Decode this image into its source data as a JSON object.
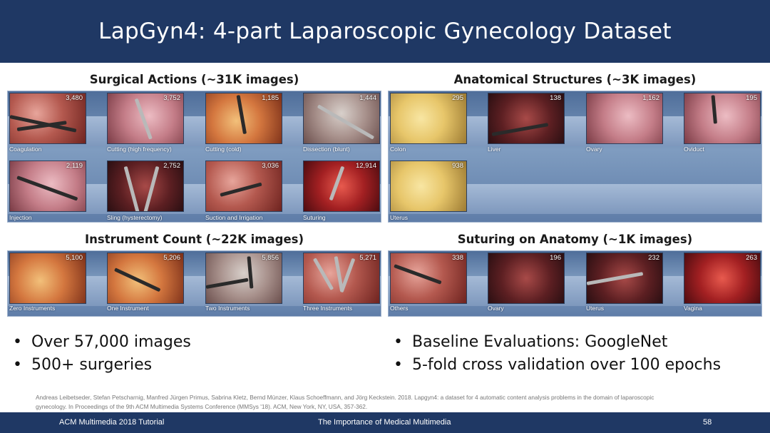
{
  "slide": {
    "title": "LapGyn4: 4-part Laparoscopic Gynecology Dataset"
  },
  "sections": {
    "surgical_actions": {
      "title": "Surgical Actions (~31K images)",
      "items": [
        {
          "label": "Coagulation",
          "count": "3,480"
        },
        {
          "label": "Cutting (high frequency)",
          "count": "3,752"
        },
        {
          "label": "Cutting (cold)",
          "count": "1,185"
        },
        {
          "label": "Dissection (blunt)",
          "count": "1,444"
        },
        {
          "label": "Injection",
          "count": "2,119"
        },
        {
          "label": "Sling (hysterectomy)",
          "count": "2,752"
        },
        {
          "label": "Suction and Irrigation",
          "count": "3,036"
        },
        {
          "label": "Suturing",
          "count": "12,914"
        }
      ]
    },
    "anatomical_structures": {
      "title": "Anatomical Structures (~3K images)",
      "items": [
        {
          "label": "Colon",
          "count": "295"
        },
        {
          "label": "Liver",
          "count": "138"
        },
        {
          "label": "Ovary",
          "count": "1,162"
        },
        {
          "label": "Oviduct",
          "count": "195"
        },
        {
          "label": "Uterus",
          "count": "938"
        }
      ]
    },
    "instrument_count": {
      "title": "Instrument Count (~22K images)",
      "items": [
        {
          "label": "Zero Instruments",
          "count": "5,100"
        },
        {
          "label": "One Instrument",
          "count": "5,206"
        },
        {
          "label": "Two Instruments",
          "count": "5,856"
        },
        {
          "label": "Three Instruments",
          "count": "5,271"
        }
      ]
    },
    "suturing_anatomy": {
      "title": "Suturing on Anatomy (~1K images)",
      "items": [
        {
          "label": "Others",
          "count": "338"
        },
        {
          "label": "Ovary",
          "count": "196"
        },
        {
          "label": "Uterus",
          "count": "232"
        },
        {
          "label": "Vagina",
          "count": "263"
        }
      ]
    }
  },
  "bullets": {
    "left": [
      "Over 57,000 images",
      "500+ surgeries"
    ],
    "right": [
      "Baseline Evaluations: GoogleNet",
      "5-fold cross validation over 100 epochs"
    ]
  },
  "citation": {
    "line1": "Andreas Leibetseder, Stefan Petscharnig, Manfred Jürgen Primus, Sabrina Kletz, Bernd Münzer, Klaus Schoeffmann, and Jörg Keckstein. 2018. Lapgyn4: a dataset for 4 automatic content analysis problems in the domain of laparoscopic",
    "line2": "gynecology. In Proceedings of the 9th ACM Multimedia Systems Conference (MMSys '18). ACM, New York, NY, USA, 357-362."
  },
  "footer": {
    "left": "ACM Multimedia 2018 Tutorial",
    "center": "The Importance of Medical Multimedia",
    "page": "58"
  },
  "colors": {
    "header_bg": "#1f3864",
    "panel_blue": "#7f9cc0"
  }
}
